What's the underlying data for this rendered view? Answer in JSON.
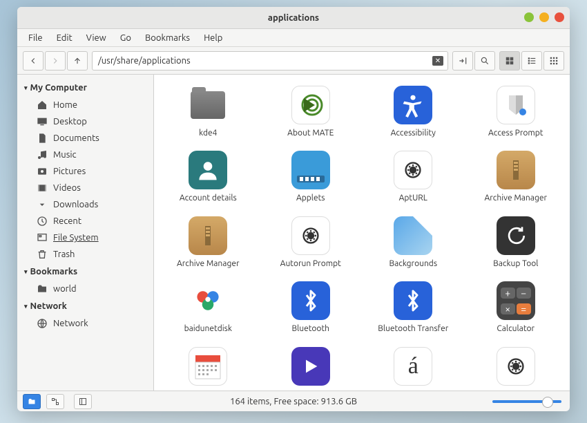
{
  "window": {
    "title": "applications"
  },
  "menu": [
    "File",
    "Edit",
    "View",
    "Go",
    "Bookmarks",
    "Help"
  ],
  "path": "/usr/share/applications",
  "sidebar": {
    "sections": [
      {
        "title": "My Computer",
        "items": [
          {
            "icon": "home",
            "label": "Home"
          },
          {
            "icon": "desktop",
            "label": "Desktop"
          },
          {
            "icon": "doc",
            "label": "Documents"
          },
          {
            "icon": "music",
            "label": "Music"
          },
          {
            "icon": "pic",
            "label": "Pictures"
          },
          {
            "icon": "video",
            "label": "Videos"
          },
          {
            "icon": "download",
            "label": "Downloads"
          },
          {
            "icon": "recent",
            "label": "Recent"
          },
          {
            "icon": "fs",
            "label": "File System",
            "underline": true
          },
          {
            "icon": "trash",
            "label": "Trash"
          }
        ]
      },
      {
        "title": "Bookmarks",
        "items": [
          {
            "icon": "folder",
            "label": "world"
          }
        ]
      },
      {
        "title": "Network",
        "items": [
          {
            "icon": "net",
            "label": "Network"
          }
        ]
      }
    ]
  },
  "apps": [
    {
      "label": "kde4",
      "kind": "folder"
    },
    {
      "label": "About MATE",
      "kind": "mate"
    },
    {
      "label": "Accessibility",
      "kind": "access"
    },
    {
      "label": "Access Prompt",
      "kind": "prompt"
    },
    {
      "label": "Account details",
      "kind": "account"
    },
    {
      "label": "Applets",
      "kind": "applets"
    },
    {
      "label": "AptURL",
      "kind": "apt"
    },
    {
      "label": "Archive Manager",
      "kind": "archive"
    },
    {
      "label": "Archive Manager",
      "kind": "archive"
    },
    {
      "label": "Autorun Prompt",
      "kind": "autorun"
    },
    {
      "label": "Backgrounds",
      "kind": "bg"
    },
    {
      "label": "Backup Tool",
      "kind": "backup"
    },
    {
      "label": "baidunetdisk",
      "kind": "baidu"
    },
    {
      "label": "Bluetooth",
      "kind": "bt"
    },
    {
      "label": "Bluetooth Transfer",
      "kind": "bt"
    },
    {
      "label": "Calculator",
      "kind": "calc"
    },
    {
      "label": "",
      "kind": "cal"
    },
    {
      "label": "",
      "kind": "play"
    },
    {
      "label": "",
      "kind": "char"
    },
    {
      "label": "",
      "kind": "gear2"
    }
  ],
  "status": "164 items, Free space: 913.6 GB"
}
